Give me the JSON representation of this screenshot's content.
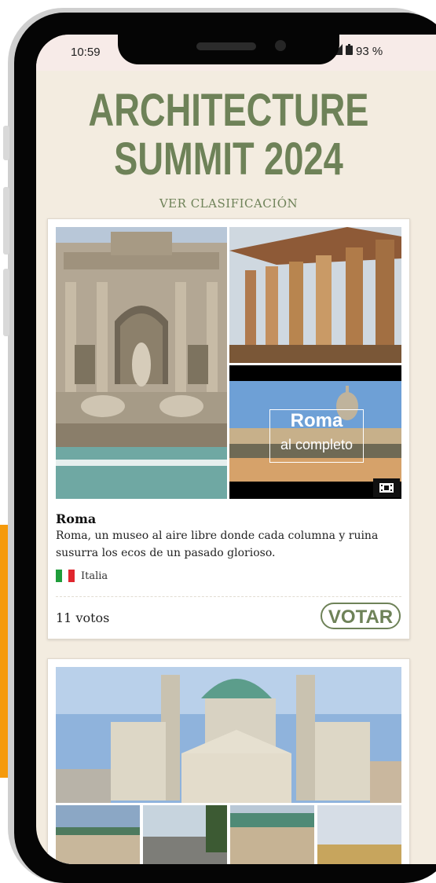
{
  "status_bar": {
    "time": "10:59",
    "battery": "93 %",
    "signal_icon": "signal-icon",
    "battery_icon": "battery-icon"
  },
  "header": {
    "title_line1": "ARCHITECTURE",
    "title_line2": "SUMMIT 2024",
    "ranking_link": "VER CLASIFICACIÓN"
  },
  "cards": [
    {
      "title": "Roma",
      "description": "Roma, un museo al aire libre donde cada columna y ruina susurra los ecos de un pasado glorioso.",
      "country": "Italia",
      "flag_colors": [
        "#1f9d3a",
        "#ffffff",
        "#e0262e"
      ],
      "votes": "11 votos",
      "vote_label": "VOTAR",
      "video_overlay": {
        "line1": "Roma",
        "line2": "al completo",
        "icon": "video-icon"
      }
    }
  ],
  "colors": {
    "accent": "#6e8258",
    "background": "#f3ece0",
    "orange_tab": "#f59a0c"
  }
}
